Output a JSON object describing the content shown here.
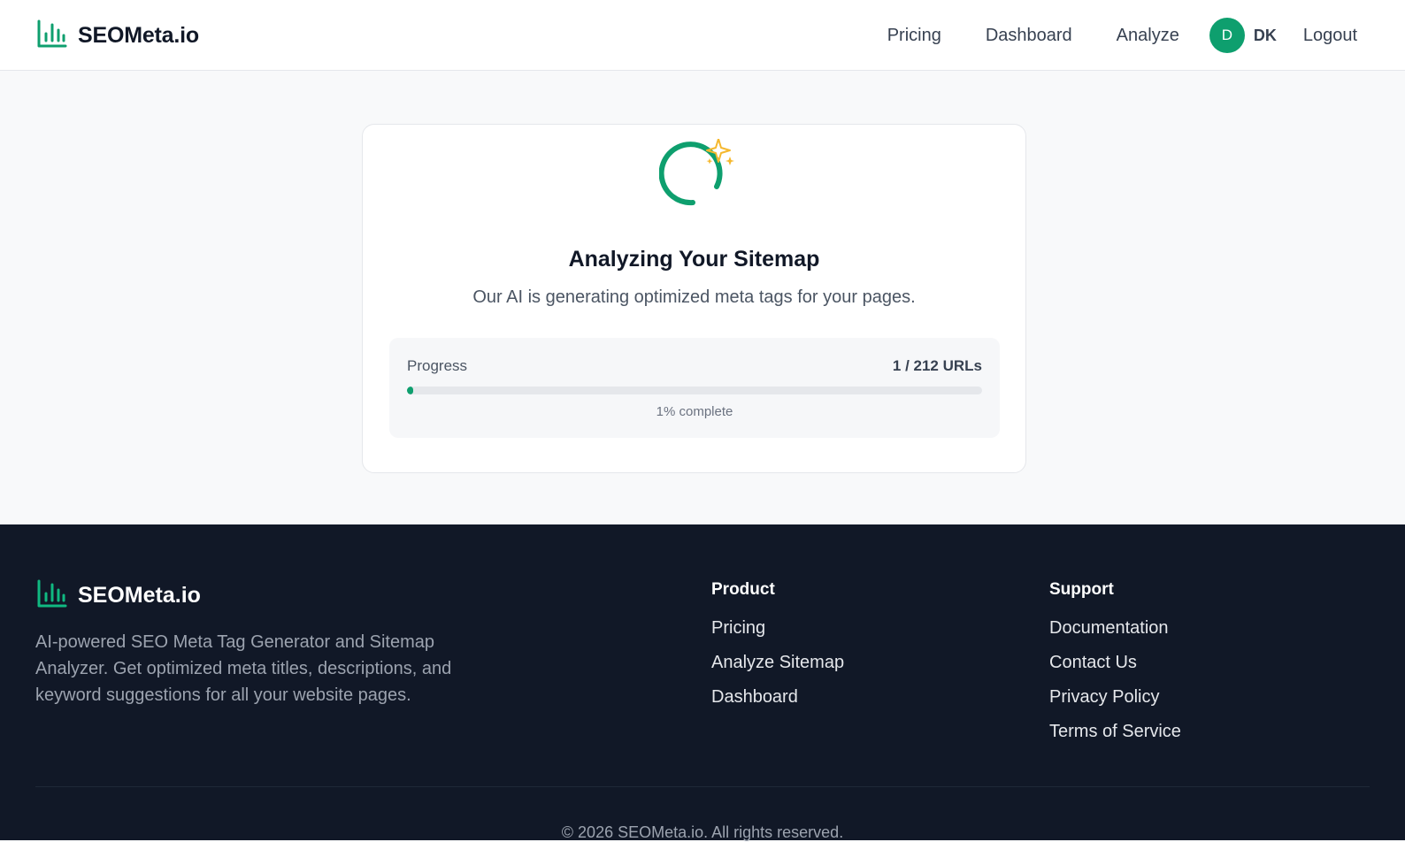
{
  "brand": {
    "name": "SEOMeta.io",
    "icon": "bar-chart-icon",
    "accent": "#0e9f6e"
  },
  "nav": {
    "links": [
      "Pricing",
      "Dashboard",
      "Analyze"
    ],
    "user": {
      "avatar_letter": "D",
      "initials": "DK"
    },
    "logout": "Logout"
  },
  "status": {
    "icon": "spinner-sparkle-icon",
    "title": "Analyzing Your Sitemap",
    "subtitle": "Our AI is generating optimized meta tags for your pages.",
    "progress_label": "Progress",
    "progress_count": "1 / 212 URLs",
    "progress_fraction": 0.01,
    "progress_pct_text": "1% complete"
  },
  "footer": {
    "brand_name": "SEOMeta.io",
    "description": "AI-powered SEO Meta Tag Generator and Sitemap Analyzer. Get optimized meta titles, descriptions, and keyword suggestions for all your website pages.",
    "columns": [
      {
        "title": "Product",
        "links": [
          "Pricing",
          "Analyze Sitemap",
          "Dashboard"
        ]
      },
      {
        "title": "Support",
        "links": [
          "Documentation",
          "Contact Us",
          "Privacy Policy",
          "Terms of Service"
        ]
      }
    ],
    "copyright": "© 2026 SEOMeta.io. All rights reserved."
  }
}
